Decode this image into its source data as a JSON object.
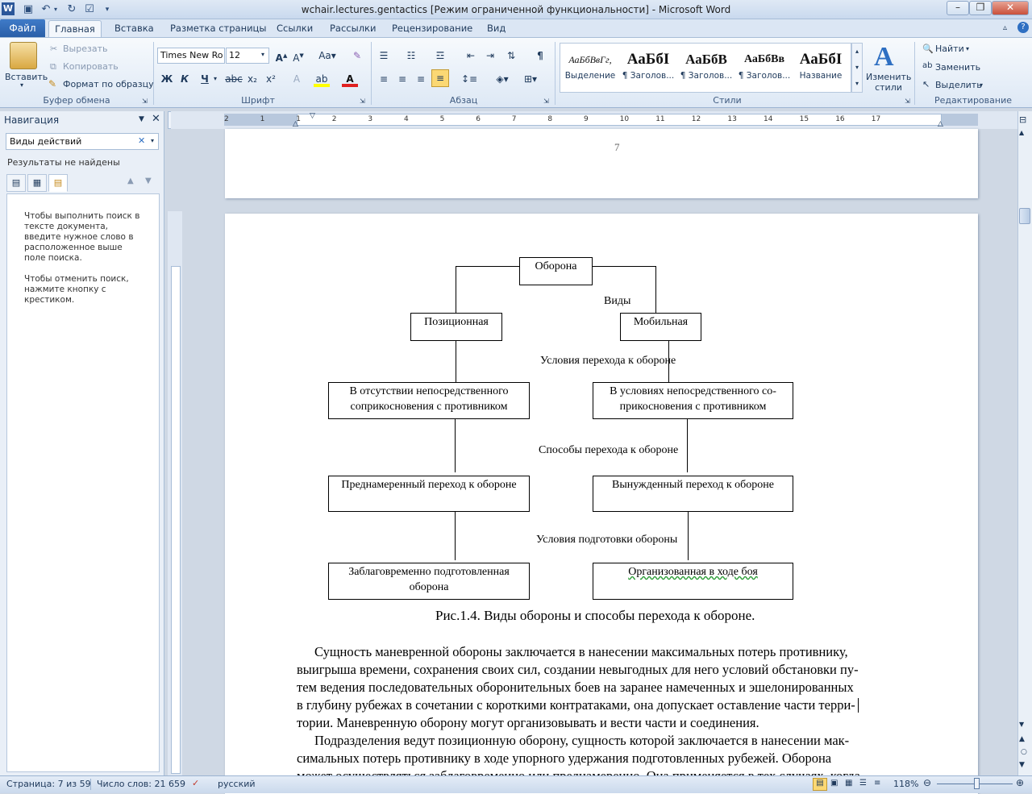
{
  "window": {
    "title": "wchair.lectures.gentactics [Режим ограниченной функциональности]  -  Microsoft Word"
  },
  "tabs": {
    "file": "Файл",
    "home": "Главная",
    "insert": "Вставка",
    "layout": "Разметка страницы",
    "refs": "Ссылки",
    "mail": "Рассылки",
    "review": "Рецензирование",
    "view": "Вид"
  },
  "clipboard": {
    "paste": "Вставить",
    "cut": "Вырезать",
    "copy": "Копировать",
    "format": "Формат по образцу",
    "label": "Буфер обмена"
  },
  "font": {
    "name": "Times New Ro",
    "size": "12",
    "label": "Шрифт"
  },
  "paragraph": {
    "label": "Абзац"
  },
  "styles": {
    "items": [
      {
        "sample": "АаБбВвГг,",
        "name": "Выделение"
      },
      {
        "sample": "АаБбI",
        "name": "¶ Заголов..."
      },
      {
        "sample": "АаБбВ",
        "name": "¶ Заголов..."
      },
      {
        "sample": "АаБбВв",
        "name": "¶ Заголов..."
      },
      {
        "sample": "АаБбI",
        "name": "Название"
      }
    ],
    "change": "Изменить стили",
    "label": "Стили"
  },
  "editing": {
    "find": "Найти",
    "replace": "Заменить",
    "select": "Выделить",
    "label": "Редактирование"
  },
  "nav": {
    "title": "Навигация",
    "search": "Виды действий",
    "no_results": "Результаты не найдены",
    "hint1": "Чтобы выполнить поиск в тексте документа, введите нужное слово в расположенное выше поле поиска.",
    "hint2": "Чтобы отменить поиск, нажмите кнопку с крестиком."
  },
  "doc": {
    "page_num": "7",
    "diagram": {
      "top": "Оборона",
      "kinds": "Виды",
      "pos": "Позиционная",
      "mob": "Мобильная",
      "cond": "Условия перехода к обороне",
      "left2": "В отсутствии непосредственного соприкосновения с противником",
      "right2": "В условиях непосредственного со-прикосновения с противником",
      "ways": "Способы перехода к обороне",
      "left3": "Преднамеренный переход к обороне",
      "right3": "Вынужденный  переход к обороне",
      "prep": "Условия подготовки обороны",
      "left4": "Заблаговременно подготовленная оборона",
      "right4": "Организованная в ходе боя"
    },
    "caption": "Рис.1.4. Виды обороны и способы перехода к обороне.",
    "lines": [
      "Сущность маневренной обороны заключается в нанесении максимальных потерь противнику,",
      "выигрыша времени, сохранения своих сил, создании невыгодных для него условий обстановки пу-",
      "тем ведения последовательных оборонительных боев на заранее намеченных и эшелонированных",
      "в глубину рубежах в сочетании с короткими контратаками, она допускает оставление части терри-",
      "тории. Маневренную оборону могут организовывать и вести части и соединения.",
      "Подразделения ведут позиционную оборону, сущность которой заключается в нанесении мак-",
      "симальных потерь противнику в ходе упорного удержания подготовленных рубежей. Оборона",
      "может осуществляться заблаговременно или преднамеренно. Она применяется в тех случаях, когда"
    ]
  },
  "status": {
    "page": "Страница: 7 из 59",
    "words": "Число слов: 21 659",
    "lang": "русский",
    "zoom": "118%"
  },
  "ruler_numbers": [
    "2",
    "1",
    "1",
    "2",
    "3",
    "4",
    "5",
    "6",
    "7",
    "8",
    "9",
    "10",
    "11",
    "12",
    "13",
    "14",
    "15",
    "16",
    "17"
  ]
}
